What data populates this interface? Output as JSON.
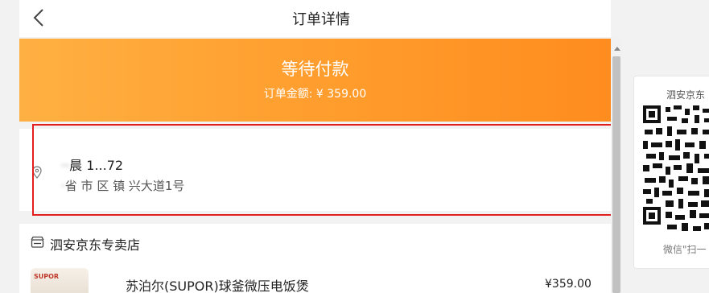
{
  "header": {
    "title": "订单详情",
    "back_icon": "back-chevron-icon"
  },
  "order": {
    "status": "等待付款",
    "amount_label": "订单金额:",
    "amount_value": "¥ 359.00",
    "banner_colors": [
      "#ffb042",
      "#ff8c1e"
    ]
  },
  "address": {
    "icon": "location-pin-icon",
    "name_line": "晨 1...72",
    "detail_line": "省 市 区 镇 兴大道1号",
    "highlight_color": "#e31e1e"
  },
  "store": {
    "icon": "store-icon",
    "name": "泗安京东专卖店",
    "product": {
      "brand_badge": "SUPOR",
      "title": "苏泊尔(SUPOR)球釜微压电饭煲",
      "price": "¥359.00"
    }
  },
  "side_panel": {
    "top_text": "泗安京东",
    "qr_icon": "qr-code-icon",
    "bottom_text": "微信\"扫一"
  }
}
